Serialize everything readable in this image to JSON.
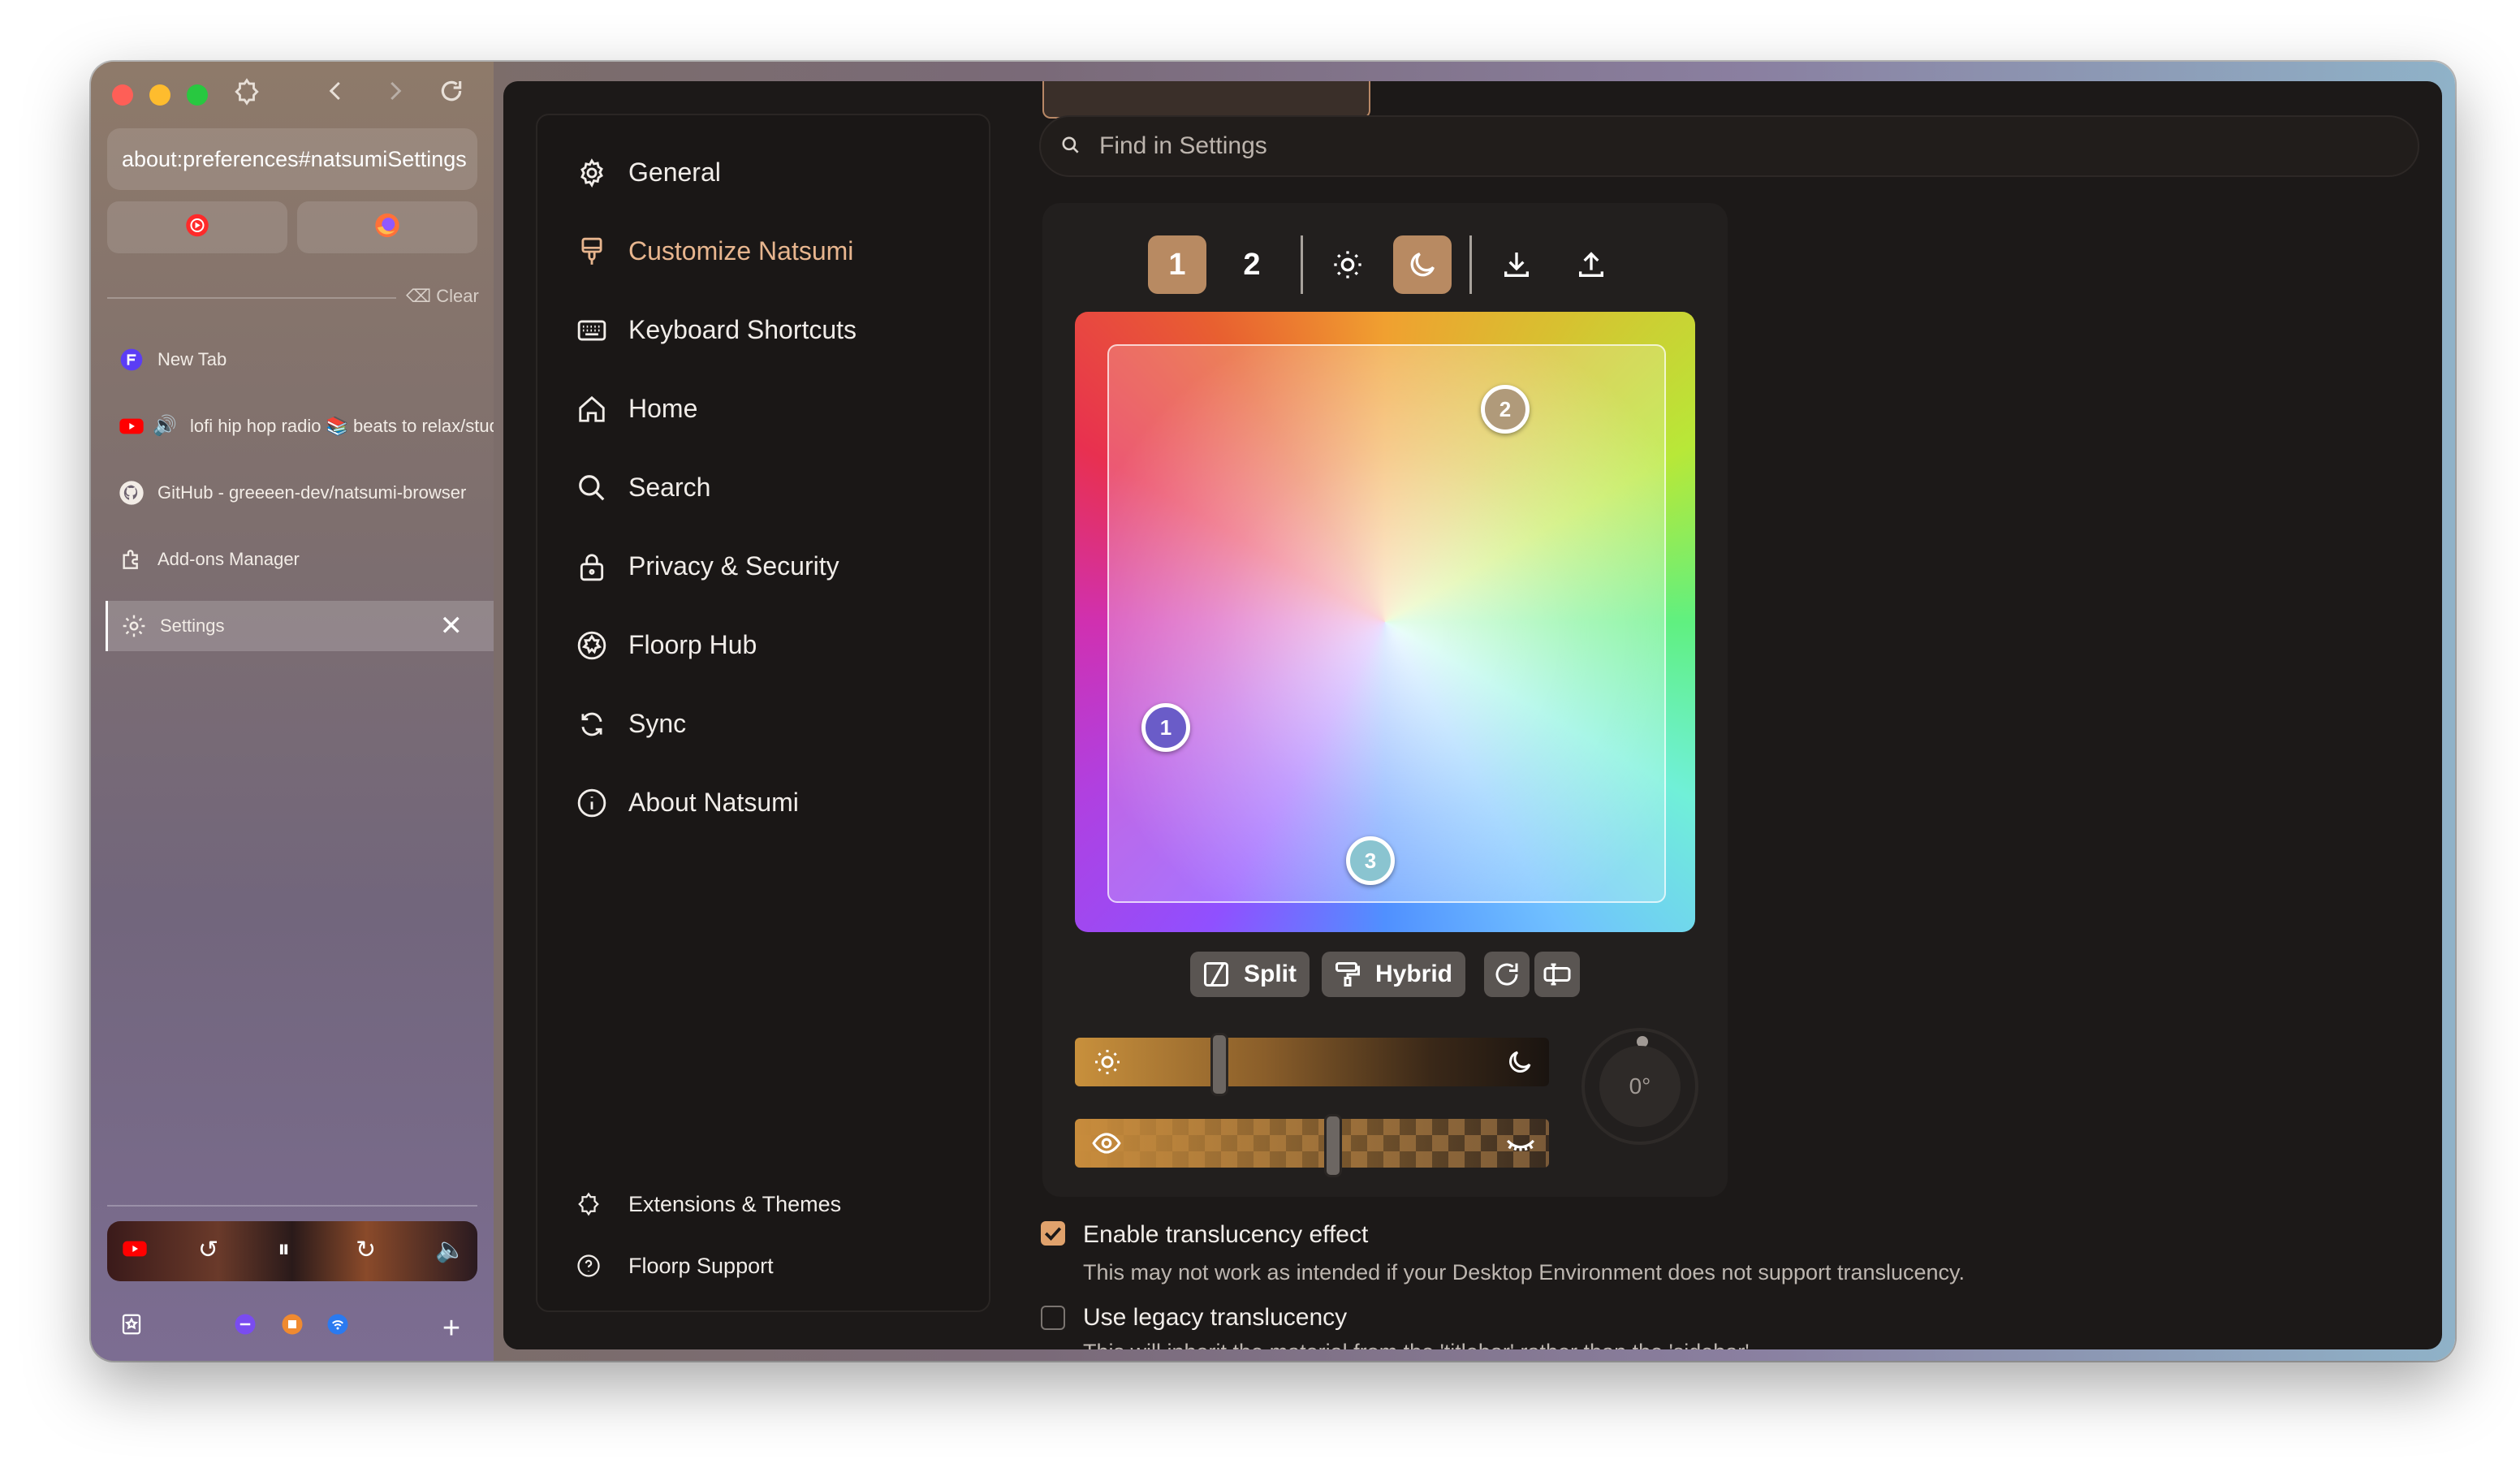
{
  "browser": {
    "url": "about:preferences#natsumiSettings",
    "clear_label": "Clear",
    "tabs": [
      {
        "label": "New Tab",
        "icon": "firefox-new-tab-icon"
      },
      {
        "label": "lofi hip hop radio 📚 beats to relax/study to",
        "icon": "youtube-icon"
      },
      {
        "label": "GitHub - greeeen-dev/natsumi-browser",
        "icon": "github-icon"
      },
      {
        "label": "Add-ons Manager",
        "icon": "puzzle-icon"
      },
      {
        "label": "Settings",
        "icon": "gear-icon",
        "active": true
      }
    ]
  },
  "settings_nav": {
    "items": [
      {
        "label": "General",
        "icon": "gear-icon"
      },
      {
        "label": "Customize Natsumi",
        "icon": "paintbrush-icon",
        "selected": true
      },
      {
        "label": "Keyboard Shortcuts",
        "icon": "keyboard-icon"
      },
      {
        "label": "Home",
        "icon": "home-icon"
      },
      {
        "label": "Search",
        "icon": "search-icon"
      },
      {
        "label": "Privacy & Security",
        "icon": "lock-icon"
      },
      {
        "label": "Floorp Hub",
        "icon": "floorp-icon"
      },
      {
        "label": "Sync",
        "icon": "sync-icon"
      },
      {
        "label": "About Natsumi",
        "icon": "info-icon"
      }
    ],
    "footer": [
      {
        "label": "Extensions & Themes",
        "icon": "puzzle-icon"
      },
      {
        "label": "Floorp Support",
        "icon": "help-icon"
      }
    ]
  },
  "search": {
    "placeholder": "Find in Settings"
  },
  "color_editor": {
    "tabs": [
      "1",
      "2"
    ],
    "selected_tab": "1",
    "theme_mode": "dark",
    "dots": [
      "1",
      "2",
      "3"
    ],
    "buttons": {
      "split": "Split",
      "hybrid": "Hybrid"
    },
    "brightness_level": 0.3,
    "opacity_level": 0.54,
    "angle": "0°",
    "accent": "#b88a62"
  },
  "options": [
    {
      "label": "Enable translucency effect",
      "checked": true,
      "description": "This may not work as intended if your Desktop Environment does not support translucency."
    },
    {
      "label": "Use legacy translucency",
      "checked": false,
      "description": "This will inherit the material from the 'titlebar' rather than the 'sidebar'."
    }
  ]
}
